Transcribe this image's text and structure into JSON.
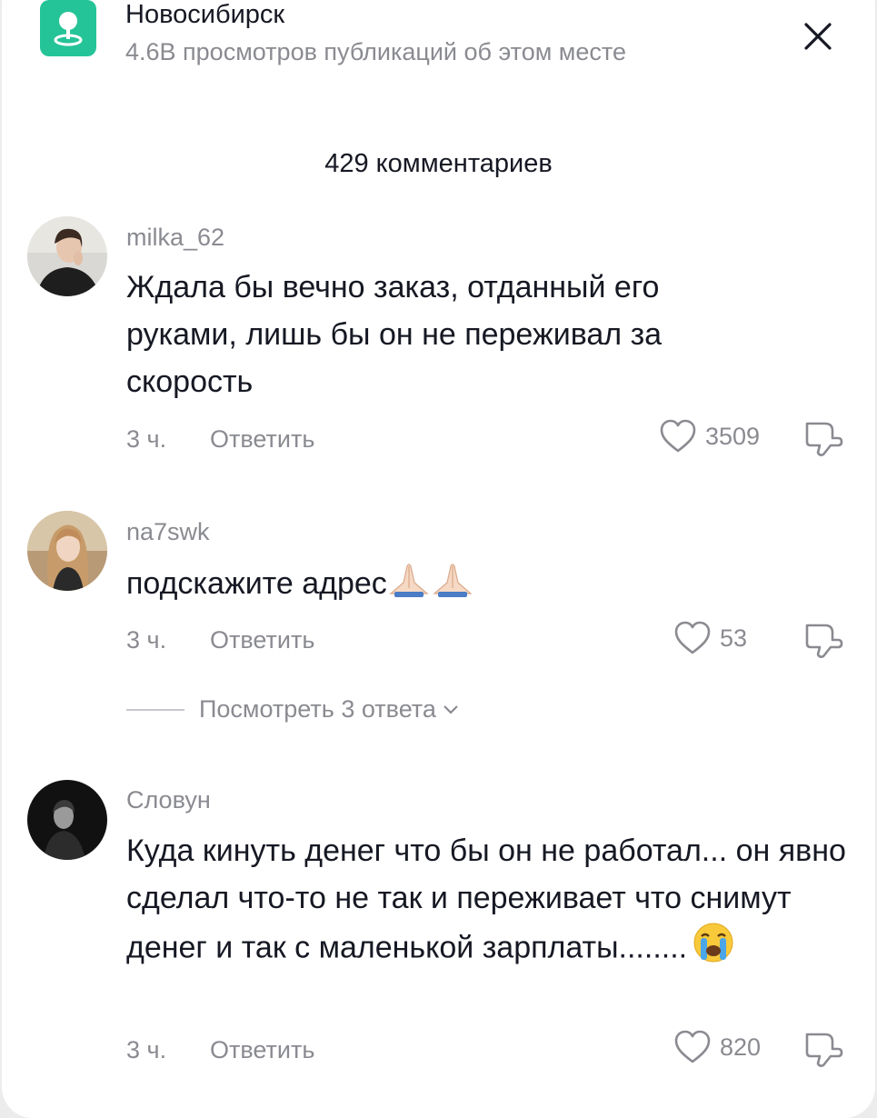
{
  "header": {
    "place_name": "Новосибирск",
    "place_subtitle": "4.6B просмотров публикаций об этом месте",
    "place_icon": "map-pin-icon",
    "close_icon": "close-icon"
  },
  "comments_count": "429 комментариев",
  "comments": [
    {
      "username": "milka_62",
      "text": "Ждала бы вечно заказ, отданный его руками, лишь бы он не переживал за скорость",
      "time": "3 ч.",
      "reply_label": "Ответить",
      "likes": "3509"
    },
    {
      "username": "na7swk",
      "text": "подскажите адрес",
      "emojis": "folded-hands-emoji ×2",
      "time": "3 ч.",
      "reply_label": "Ответить",
      "likes": "53",
      "view_replies": "Посмотреть 3 ответа"
    },
    {
      "username": "Словун",
      "text": "Куда кинуть денег что бы он не работал... он явно сделал что-то не так и переживает что снимут денег и так с маленькой зарплаты........",
      "emojis": "loudly-crying-face-emoji",
      "time": "3 ч.",
      "reply_label": "Ответить",
      "likes": "820"
    }
  ],
  "colors": {
    "accent_green": "#25c498",
    "text_primary": "#161823",
    "text_secondary": "#8a8b91"
  }
}
